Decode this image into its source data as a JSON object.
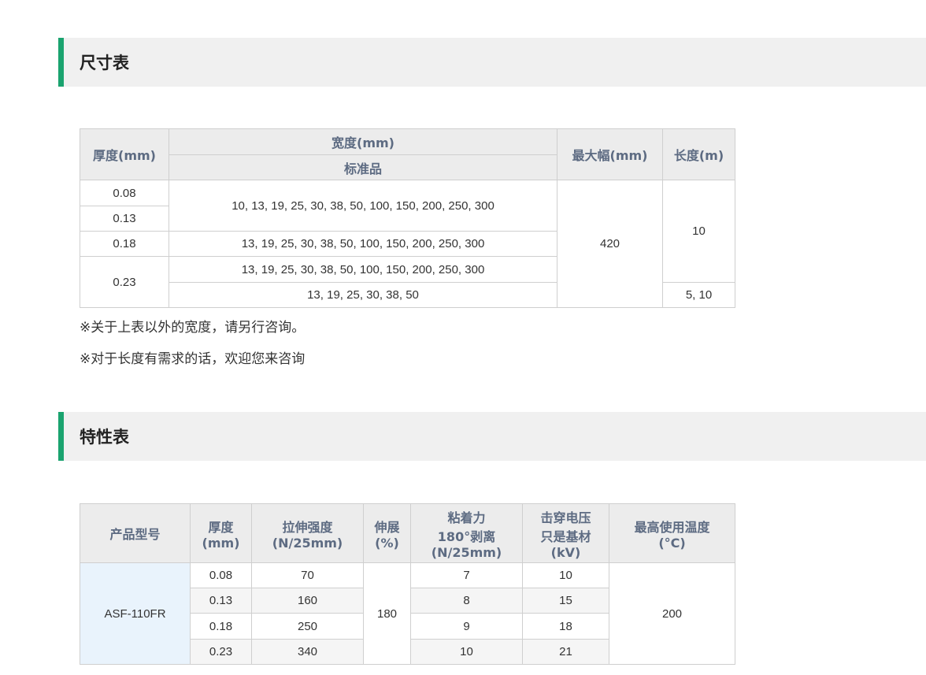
{
  "size_section": {
    "title": "尺寸表",
    "headers": {
      "thickness": "厚度(mm)",
      "width": "宽度(mm)",
      "standard": "标准品",
      "max_width": "最大幅(mm)",
      "length": "长度(m)"
    },
    "thickness": [
      "0.08",
      "0.13",
      "0.18",
      "0.23"
    ],
    "widths": [
      "10, 13, 19, 25, 30, 38, 50, 100, 150, 200, 250, 300",
      "13, 19, 25, 30, 38, 50, 100, 150, 200, 250, 300",
      "13, 19, 25, 30, 38, 50, 100, 150, 200, 250, 300",
      "13, 19, 25, 30, 38, 50"
    ],
    "max_width_value": "420",
    "lengths": [
      "10",
      "5, 10"
    ],
    "notes": [
      "※关于上表以外的宽度，请另行咨询。",
      "※对于长度有需求的话，欢迎您来咨询"
    ]
  },
  "property_section": {
    "title": "特性表",
    "headers": {
      "model": "产品型号",
      "thickness": [
        "厚度",
        "(mm)"
      ],
      "tensile": [
        "拉伸强度",
        "(N/25mm)"
      ],
      "elongation": [
        "伸展",
        "(%)"
      ],
      "adhesion": [
        "粘着力",
        "180°剥离",
        "(N/25mm)"
      ],
      "breakdown": [
        "击穿电压",
        "只是基材",
        "(kV)"
      ],
      "max_temp": [
        "最高使用温度",
        "(°C)"
      ]
    },
    "model": "ASF-110FR",
    "rows": [
      {
        "thickness": "0.08",
        "tensile": "70",
        "adhesion": "7",
        "breakdown": "10"
      },
      {
        "thickness": "0.13",
        "tensile": "160",
        "adhesion": "8",
        "breakdown": "15"
      },
      {
        "thickness": "0.18",
        "tensile": "250",
        "adhesion": "9",
        "breakdown": "18"
      },
      {
        "thickness": "0.23",
        "tensile": "340",
        "adhesion": "10",
        "breakdown": "21"
      }
    ],
    "elongation_value": "180",
    "max_temp_value": "200"
  },
  "colors": {
    "accent": "#1aa36f",
    "header_bg": "#ececec",
    "header_text": "#5d6b82",
    "product_bg": "#e9f3fc"
  }
}
